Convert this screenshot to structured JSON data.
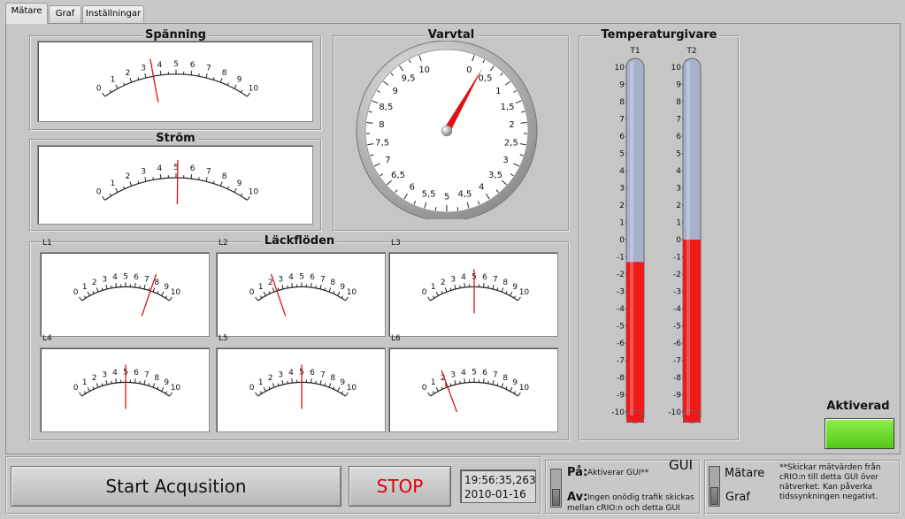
{
  "tabs": [
    {
      "label": "Mätare",
      "active": true
    },
    {
      "label": "Graf",
      "active": false
    },
    {
      "label": "Inställningar",
      "active": false
    }
  ],
  "voltage": {
    "title": "Spänning",
    "value": 3.5,
    "min": 0,
    "max": 10,
    "ticks": [
      "0",
      "1",
      "2",
      "3",
      "4",
      "5",
      "6",
      "7",
      "8",
      "9",
      "10"
    ]
  },
  "current": {
    "title": "Ström",
    "value": 5.1,
    "min": 0,
    "max": 10,
    "ticks": [
      "0",
      "1",
      "2",
      "3",
      "4",
      "5",
      "6",
      "7",
      "8",
      "9",
      "10"
    ]
  },
  "rpm": {
    "title": "Varvtal",
    "value": 0.3,
    "ticks": [
      "0",
      "0,5",
      "1",
      "1,5",
      "2",
      "2,5",
      "3",
      "3,5",
      "4",
      "4,5",
      "5",
      "5,5",
      "6",
      "6,5",
      "7",
      "7,5",
      "8",
      "8,5",
      "9",
      "9,5",
      "10"
    ]
  },
  "leakage": {
    "title": "Läckflöden",
    "meters": [
      {
        "label": "L1",
        "value": 7.7
      },
      {
        "label": "L2",
        "value": 2.3
      },
      {
        "label": "L3",
        "value": 5.0
      },
      {
        "label": "L4",
        "value": 5.0
      },
      {
        "label": "L5",
        "value": 5.0
      },
      {
        "label": "L6",
        "value": 2.1
      }
    ]
  },
  "temperature": {
    "title": "Temperaturgivare",
    "scale": [
      "10",
      "9",
      "8",
      "7",
      "6",
      "5",
      "4",
      "3",
      "2",
      "1",
      "0",
      "-1",
      "-2",
      "-3",
      "-4",
      "-5",
      "-6",
      "-7",
      "-8",
      "-9",
      "-10"
    ],
    "sensors": [
      {
        "label": "T1",
        "value": -1.3
      },
      {
        "label": "T2",
        "value": 0.0
      }
    ]
  },
  "activated": {
    "label": "Aktiverad",
    "color": "#66dd22"
  },
  "controls": {
    "start_label": "Start Acqusition",
    "stop_label": "STOP"
  },
  "timestamp": {
    "time": "19:56:35,263",
    "date": "2010-01-16"
  },
  "gui_switch": {
    "title": "GUI",
    "on_label": "På:",
    "on_desc": "Aktiverar GUI**",
    "off_label": "Av:",
    "off_desc_line1": "Ingen onödig trafik skickas",
    "off_desc_line2": "mellan cRIO:n och detta GUI"
  },
  "mode_switch": {
    "option1": "Mätare",
    "option2": "Graf"
  },
  "note": {
    "line1": "**Skickar mätvärden från",
    "line2": "cRIO:n till detta GUI över",
    "line3": "nätverket. Kan påverka",
    "line4": "tidssynkningen negativt."
  },
  "colors": {
    "needle": "#dd1111",
    "mercury": "#ee1a1a",
    "tube_empty": "#a8b0cc",
    "lamp_on": "#66dd22"
  }
}
